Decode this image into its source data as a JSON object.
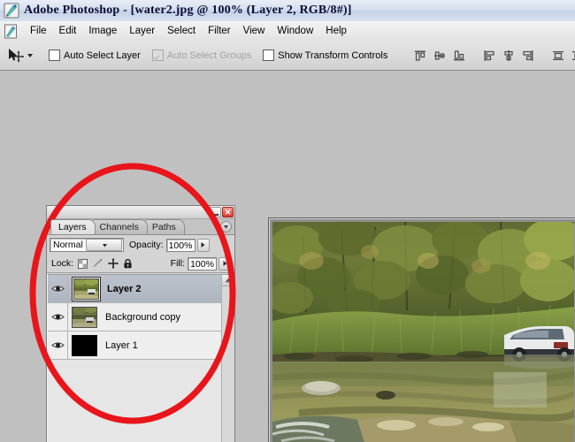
{
  "window": {
    "title": "Adobe Photoshop - [water2.jpg @ 100% (Layer 2, RGB/8#)]",
    "app_icon": "photoshop-feather-icon"
  },
  "menubar": {
    "icon": "document-feather-icon",
    "items": [
      {
        "label": "File"
      },
      {
        "label": "Edit"
      },
      {
        "label": "Image"
      },
      {
        "label": "Layer"
      },
      {
        "label": "Select"
      },
      {
        "label": "Filter"
      },
      {
        "label": "View"
      },
      {
        "label": "Window"
      },
      {
        "label": "Help"
      }
    ]
  },
  "options_bar": {
    "tool_icon": "move-tool-icon",
    "tool_preset_caret": "chevron-down-icon",
    "checkboxes": [
      {
        "label": "Auto Select Layer",
        "checked": false,
        "disabled": false
      },
      {
        "label": "Auto Select Groups",
        "checked": true,
        "disabled": true
      },
      {
        "label": "Show Transform Controls",
        "checked": false,
        "disabled": false
      }
    ],
    "align_group_1": [
      "align-top-edges-icon",
      "align-vertical-centers-icon",
      "align-bottom-edges-icon"
    ],
    "align_group_2": [
      "align-left-edges-icon",
      "align-horizontal-centers-icon",
      "align-right-edges-icon"
    ],
    "align_group_3": [
      "distribute-top-edges-icon",
      "distribute-vertical-centers-icon",
      "distribute-bottom-edges-icon",
      "distribute-left-edges-icon"
    ]
  },
  "layers_palette": {
    "minimize_icon": "minimize-icon",
    "close_icon": "close-icon",
    "close_label": "✕",
    "menu_icon": "palette-menu-icon",
    "tabs": [
      {
        "label": "Layers",
        "active": true
      },
      {
        "label": "Channels",
        "active": false
      },
      {
        "label": "Paths",
        "active": false
      }
    ],
    "blend_mode": {
      "value": "Normal",
      "dropdown_icon": "chevron-down-icon"
    },
    "opacity": {
      "label": "Opacity:",
      "value": "100%",
      "spinner_icon": "slider-arrow-icon"
    },
    "lock": {
      "label": "Lock:",
      "icons": [
        "lock-transparent-pixels-icon",
        "lock-image-pixels-icon",
        "lock-position-icon",
        "lock-all-icon"
      ]
    },
    "fill": {
      "label": "Fill:",
      "value": "100%",
      "spinner_icon": "slider-arrow-icon"
    },
    "scrollbar": {
      "up_arrow_icon": "scroll-up-icon"
    },
    "layers": [
      {
        "name": "Layer 2",
        "selected": true,
        "visible": true,
        "visibility_icon": "eye-icon",
        "thumbnail": "creek-photo-thumbnail"
      },
      {
        "name": "Background copy",
        "selected": false,
        "visible": true,
        "visibility_icon": "eye-icon",
        "thumbnail": "creek-photo-thumbnail"
      },
      {
        "name": "Layer 1",
        "selected": false,
        "visible": true,
        "visibility_icon": "eye-icon",
        "thumbnail": "black-fill-thumbnail"
      }
    ]
  },
  "document_window": {
    "image_description": "creek-with-parked-car-photo"
  },
  "annotation": {
    "shape": "red-ellipse-highlight",
    "color": "#e8151b"
  },
  "colors": {
    "workspace_background": "#c0c0c0",
    "titlebar": "#d4dfee",
    "palette_background": "#d4d4d4",
    "selected_layer": "#b6bdc7",
    "annotation_red": "#e8151b"
  }
}
